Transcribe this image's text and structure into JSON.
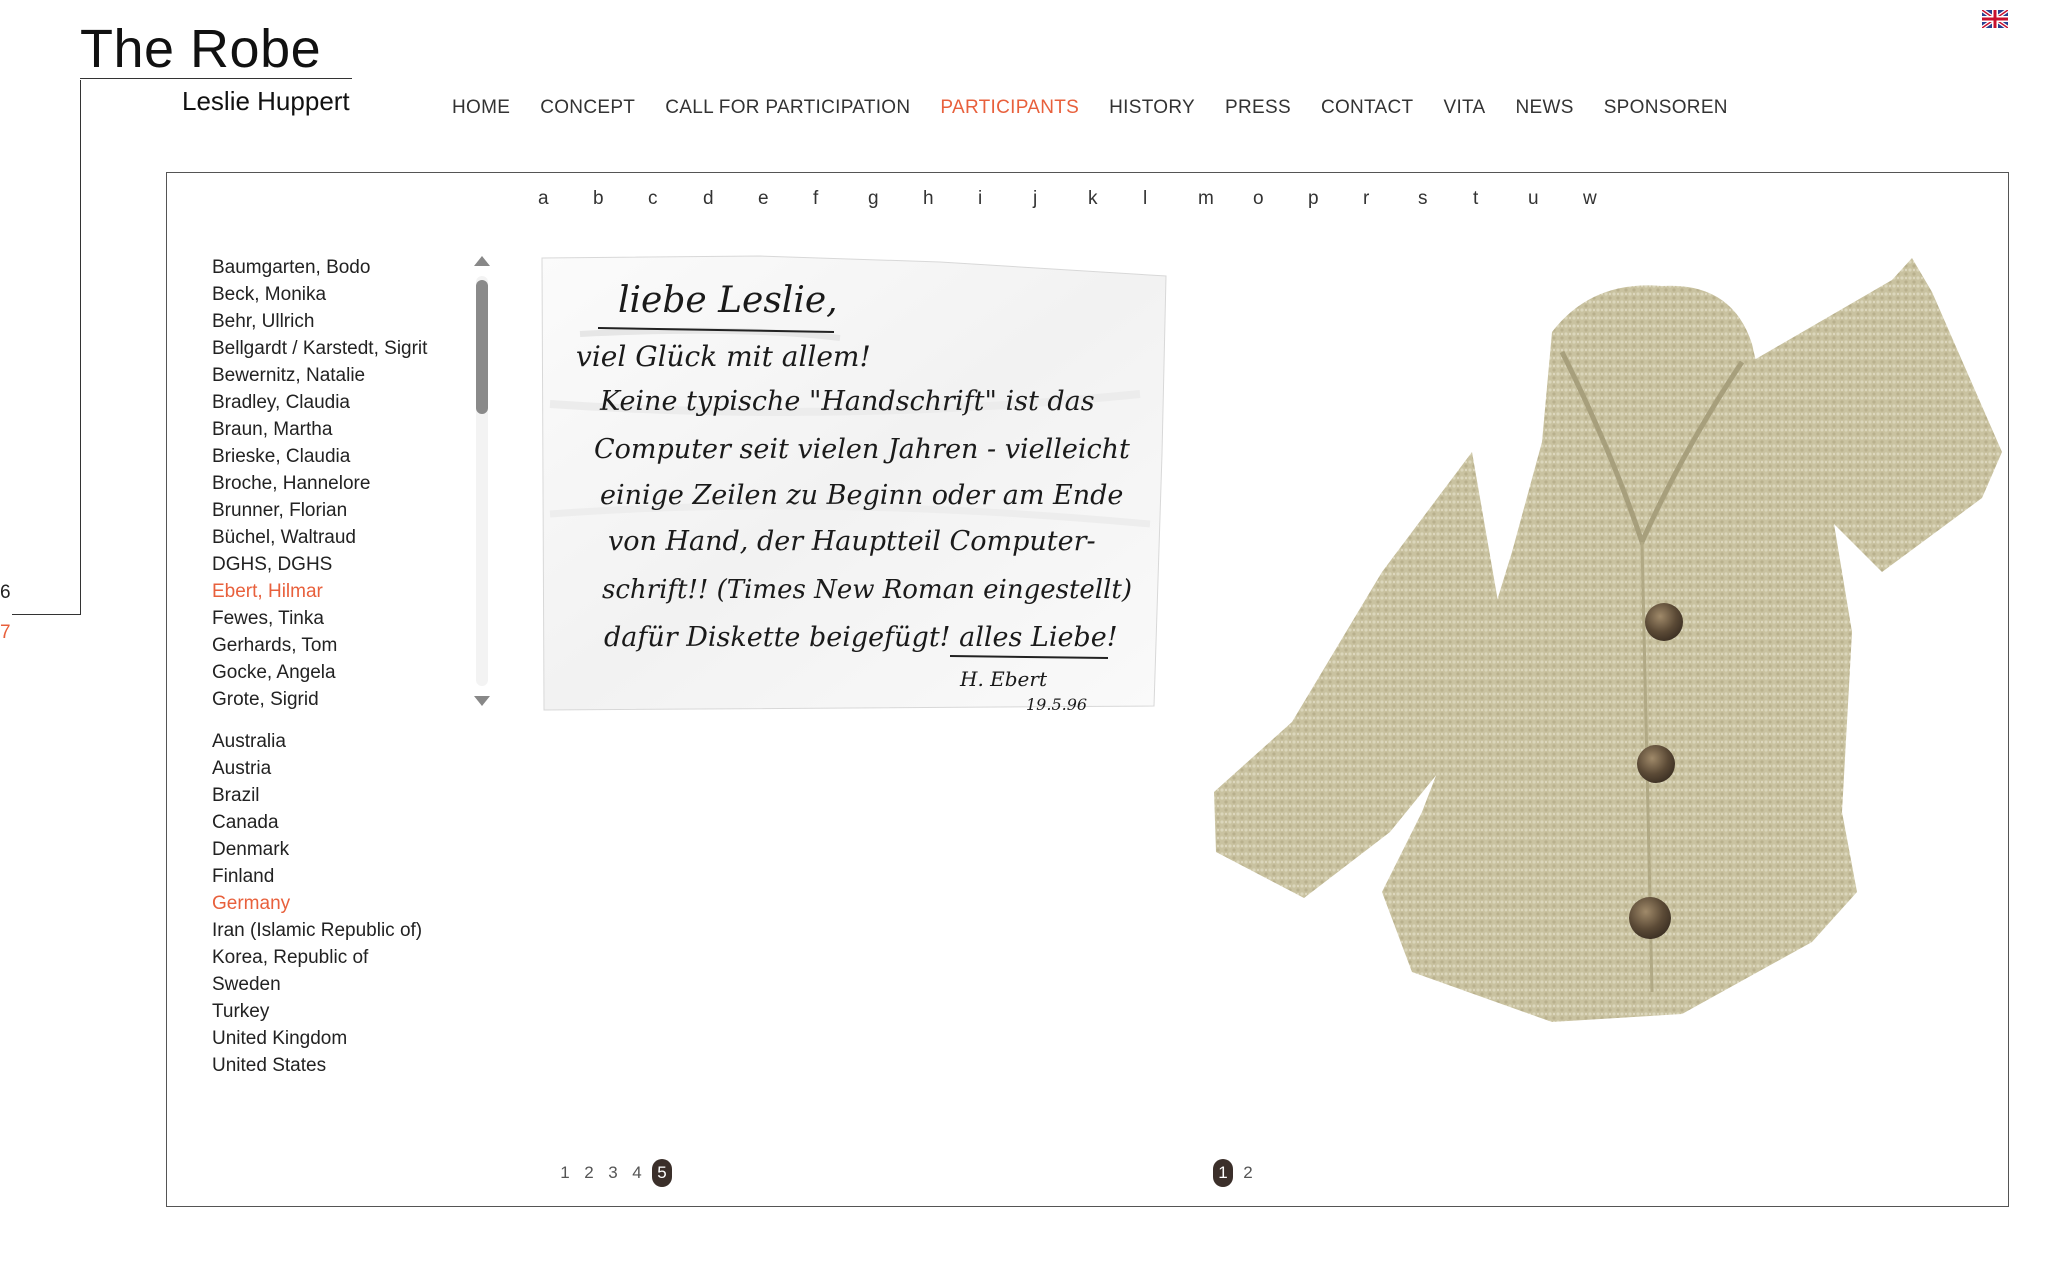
{
  "header": {
    "title": "The Robe",
    "subtitle": "Leslie Huppert",
    "page_current": "6",
    "page_next": "7",
    "language_icon": "uk-flag-icon"
  },
  "nav": {
    "items": [
      {
        "label": "HOME",
        "active": false
      },
      {
        "label": "CONCEPT",
        "active": false
      },
      {
        "label": "CALL FOR PARTICIPATION",
        "active": false
      },
      {
        "label": "PARTICIPANTS",
        "active": true
      },
      {
        "label": "HISTORY",
        "active": false
      },
      {
        "label": "PRESS",
        "active": false
      },
      {
        "label": "CONTACT",
        "active": false
      },
      {
        "label": "VITA",
        "active": false
      },
      {
        "label": "NEWS",
        "active": false
      },
      {
        "label": "SPONSOREN",
        "active": false
      }
    ],
    "active_color": "#e8603c"
  },
  "alphabet": [
    "a",
    "b",
    "c",
    "d",
    "e",
    "f",
    "g",
    "h",
    "i",
    "j",
    "k",
    "l",
    "m",
    "o",
    "p",
    "r",
    "s",
    "t",
    "u",
    "w"
  ],
  "participants": [
    {
      "name": "Baumgarten, Bodo",
      "active": false
    },
    {
      "name": "Beck, Monika",
      "active": false
    },
    {
      "name": "Behr, Ullrich",
      "active": false
    },
    {
      "name": "Bellgardt / Karstedt, Sigrit",
      "active": false
    },
    {
      "name": "Bewernitz, Natalie",
      "active": false
    },
    {
      "name": "Bradley, Claudia",
      "active": false
    },
    {
      "name": "Braun, Martha",
      "active": false
    },
    {
      "name": "Brieske, Claudia",
      "active": false
    },
    {
      "name": "Broche, Hannelore",
      "active": false
    },
    {
      "name": "Brunner, Florian",
      "active": false
    },
    {
      "name": "Büchel, Waltraud",
      "active": false
    },
    {
      "name": "DGHS, DGHS",
      "active": false
    },
    {
      "name": "Ebert, Hilmar",
      "active": true
    },
    {
      "name": "Fewes, Tinka",
      "active": false
    },
    {
      "name": "Gerhards, Tom",
      "active": false
    },
    {
      "name": "Gocke, Angela",
      "active": false
    },
    {
      "name": "Grote, Sigrid",
      "active": false
    }
  ],
  "countries": [
    {
      "name": "Australia",
      "active": false
    },
    {
      "name": "Austria",
      "active": false
    },
    {
      "name": "Brazil",
      "active": false
    },
    {
      "name": "Canada",
      "active": false
    },
    {
      "name": "Denmark",
      "active": false
    },
    {
      "name": "Finland",
      "active": false
    },
    {
      "name": "Germany",
      "active": true
    },
    {
      "name": "Iran (Islamic Republic of)",
      "active": false
    },
    {
      "name": "Korea, Republic of",
      "active": false
    },
    {
      "name": "Sweden",
      "active": false
    },
    {
      "name": "Turkey",
      "active": false
    },
    {
      "name": "United Kingdom",
      "active": false
    },
    {
      "name": "United States",
      "active": false
    }
  ],
  "letter": {
    "lines": [
      "liebe Leslie,",
      "viel Glück mit allem!",
      "Keine typische \"Handschrift\" ist das",
      "Computer seit vielen Jahren - vielleicht",
      "einige Zeilen zu Beginn oder am Ende",
      "von Hand, der Hauptteil Computer-",
      "schrift!! (Times New Roman eingestellt)",
      "dafür Diskette beigefügt!    alles Liebe!",
      "H. Ebert",
      "19.5.96"
    ]
  },
  "letter_pager": {
    "pages": [
      "1",
      "2",
      "3",
      "4",
      "5"
    ],
    "active": "5"
  },
  "robe_pager": {
    "pages": [
      "1",
      "2"
    ],
    "active": "1"
  }
}
